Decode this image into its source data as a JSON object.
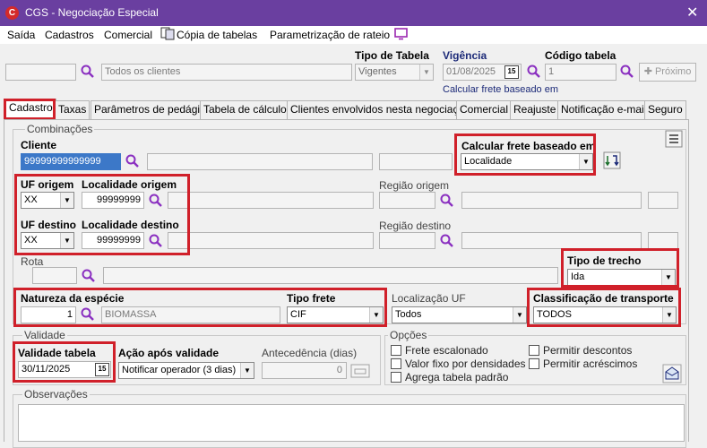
{
  "window": {
    "title": "CGS - Negociação Especial",
    "app_icon": "C",
    "close": "✕"
  },
  "menu": {
    "items": [
      "Saída",
      "Cadastros",
      "Comercial",
      "Cópia de tabelas",
      "Parametrização de rateio"
    ]
  },
  "top": {
    "client_code": "",
    "client_name": "Todos os clientes",
    "tipo_tabela_label": "Tipo de Tabela",
    "tipo_tabela_value": "Vigentes",
    "vigencia_label": "Vigência",
    "vigencia_value": "01/08/2025",
    "codigo_tabela_label": "Código tabela",
    "codigo_tabela_value": "1",
    "proximo_label": "Próximo",
    "calc_link": "Calcular frete baseado em"
  },
  "tabs": [
    "Cadastro",
    "Taxas",
    "Parâmetros de pedágio",
    "Tabela de cálculo",
    "Clientes envolvidos nesta negociação",
    "Comercial",
    "Reajuste",
    "Notificação e-mail",
    "Seguro"
  ],
  "combinacoes": {
    "title": "Combinações",
    "cliente_label": "Cliente",
    "cliente_value": "99999999999999",
    "calcular_label": "Calcular frete baseado em",
    "calcular_value": "Localidade",
    "uf_origem_label": "UF origem",
    "uf_origem_value": "XX",
    "loc_origem_label": "Localidade origem",
    "loc_origem_value": "99999999",
    "regiao_origem_label": "Região origem",
    "uf_destino_label": "UF destino",
    "uf_destino_value": "XX",
    "loc_destino_label": "Localidade destino",
    "loc_destino_value": "99999999",
    "regiao_destino_label": "Região destino",
    "rota_label": "Rota",
    "tipo_trecho_label": "Tipo de trecho",
    "tipo_trecho_value": "Ida",
    "natureza_label": "Natureza da espécie",
    "natureza_code": "1",
    "natureza_name": "BIOMASSA",
    "tipo_frete_label": "Tipo frete",
    "tipo_frete_value": "CIF",
    "localizacao_uf_label": "Localização UF",
    "localizacao_uf_value": "Todos",
    "classificacao_label": "Classificação de transporte",
    "classificacao_value": "TODOS"
  },
  "validade": {
    "title": "Validade",
    "validade_label": "Validade tabela",
    "validade_value": "30/11/2025",
    "acao_label": "Ação após validade",
    "acao_value": "Notificar operador (3 dias)",
    "antecedencia_label": "Antecedência (dias)",
    "antecedencia_value": "0"
  },
  "opcoes": {
    "title": "Opções",
    "items": [
      "Frete escalonado",
      "Valor fixo por densidades",
      "Agrega tabela padrão",
      "Permitir descontos",
      "Permitir acréscimos"
    ]
  },
  "observacoes": {
    "title": "Observações"
  },
  "calendar_glyph": "15",
  "colors": {
    "titlebar": "#6a3fa0",
    "highlight": "#d0202a",
    "selection": "#3c78c8"
  }
}
